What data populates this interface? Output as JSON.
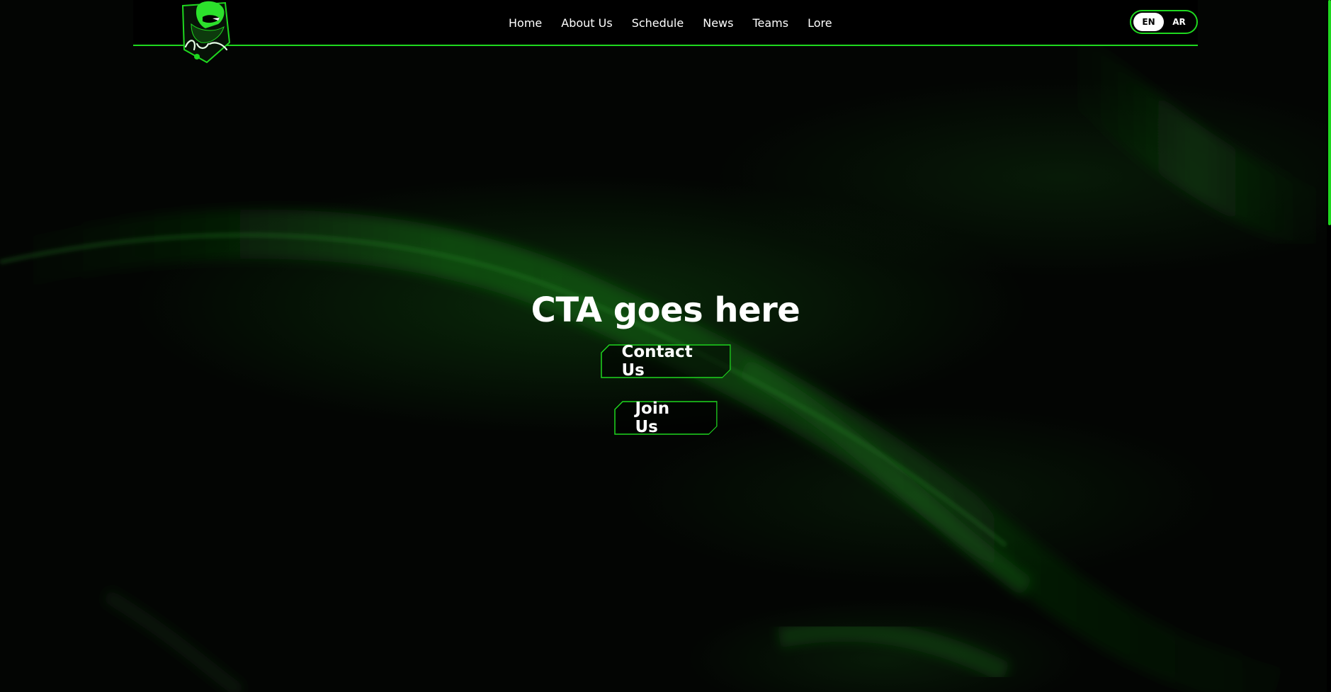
{
  "header": {
    "logo_icon": "clan-knight-logo-icon",
    "nav": [
      {
        "label": "Home"
      },
      {
        "label": "About Us"
      },
      {
        "label": "Schedule"
      },
      {
        "label": "News"
      },
      {
        "label": "Teams"
      },
      {
        "label": "Lore"
      }
    ],
    "language": {
      "active": "EN",
      "inactive": "AR"
    }
  },
  "hero": {
    "title": "CTA goes here",
    "buttons": [
      {
        "label": "Contact Us"
      },
      {
        "label": "Join Us"
      }
    ]
  },
  "colors": {
    "accent": "#1fd81f",
    "background": "#000000",
    "text": "#ffffff"
  }
}
